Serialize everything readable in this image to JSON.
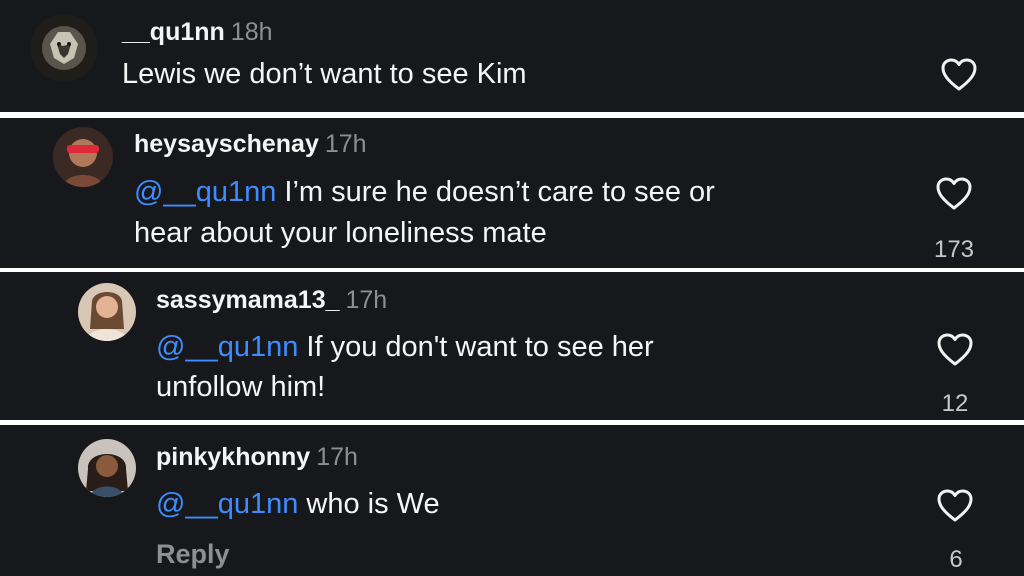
{
  "comments": [
    {
      "username": "__qu1nn",
      "time": "18h",
      "text": "Lewis we don’t want to see Kim",
      "avatar_icon": "lion-avatar-icon"
    },
    {
      "username": "heysayschenay",
      "time": "17h",
      "mention": "@__qu1nn",
      "text_line1": " I’m sure he doesn’t care to see or",
      "text_line2": "hear about your loneliness mate",
      "likes": "173"
    },
    {
      "username": "sassymama13_",
      "time": "17h",
      "mention": "@__qu1nn",
      "text_line1": " If you don't want to see her",
      "text_line2": "unfollow him!",
      "likes": "12"
    },
    {
      "username": "pinkykhonny",
      "time": "17h",
      "mention": "@__qu1nn",
      "text_line1": " who is We",
      "reply_label": "Reply",
      "likes": "6"
    }
  ],
  "colors": {
    "background": "#17181b",
    "mention": "#3f8cff",
    "meta": "#8e8e93",
    "separator": "#ffffff"
  }
}
